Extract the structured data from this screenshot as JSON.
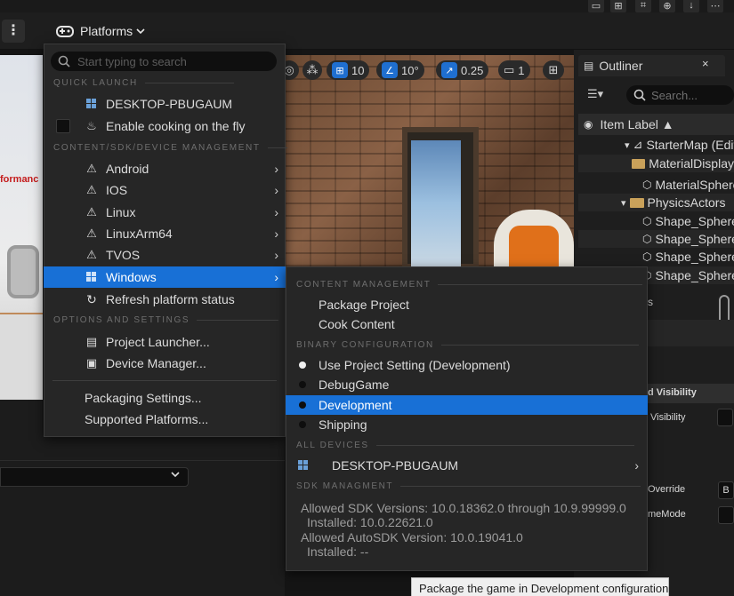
{
  "toolbar": {
    "platforms_label": "Platforms",
    "kebab_label": "⋮"
  },
  "platforms_menu": {
    "search_placeholder": "Start typing to search",
    "sections": {
      "quick_launch": "QUICK LAUNCH",
      "content_sdk": "CONTENT/SDK/DEVICE MANAGEMENT",
      "options": "OPTIONS AND SETTINGS"
    },
    "quick_launch": {
      "device": "DESKTOP-PBUGAUM",
      "cooking": "Enable cooking on the fly"
    },
    "platforms": [
      {
        "label": "Android"
      },
      {
        "label": "IOS"
      },
      {
        "label": "Linux"
      },
      {
        "label": "LinuxArm64"
      },
      {
        "label": "TVOS"
      },
      {
        "label": "Windows",
        "selected": true
      }
    ],
    "refresh": "Refresh platform status",
    "options": {
      "project_launcher": "Project Launcher...",
      "device_manager": "Device Manager..."
    },
    "packaging_settings": "Packaging Settings...",
    "supported_platforms": "Supported Platforms..."
  },
  "windows_menu": {
    "sections": {
      "content": "CONTENT MANAGEMENT",
      "binary": "BINARY CONFIGURATION",
      "all_devices": "ALL DEVICES",
      "sdk": "SDK MANAGMENT"
    },
    "package_project": "Package Project",
    "cook_content": "Cook Content",
    "configs": [
      {
        "label": "Use Project Setting (Development)",
        "checked": true
      },
      {
        "label": "DebugGame",
        "checked": false
      },
      {
        "label": "Development",
        "checked": false,
        "highlighted": true
      },
      {
        "label": "Shipping",
        "checked": false
      }
    ],
    "device": "DESKTOP-PBUGAUM",
    "sdk_lines": [
      "Allowed SDK Versions: 10.0.18362.0 through 10.9.99999.0",
      "Installed: 10.0.22621.0",
      "Allowed AutoSDK Version: 10.0.19041.0",
      "Installed: --"
    ]
  },
  "viewport_toolbar": {
    "grid_value": "10",
    "angle_value": "10°",
    "scale_value": "0.25",
    "camera_value": "1"
  },
  "outliner": {
    "title": "Outliner",
    "close": "×",
    "search_placeholder": "Search...",
    "column_header": "Item Label ▲",
    "rows": [
      {
        "label": "StarterMap (Editor)"
      },
      {
        "label": "MaterialDisplay"
      },
      {
        "label": "MaterialSphere"
      },
      {
        "label": "PhysicsActors"
      },
      {
        "label": "Shape_Sphere"
      },
      {
        "label": "Shape_Sphere"
      },
      {
        "label": "Shape_Sphere"
      },
      {
        "label": "Shape_Sphere"
      }
    ]
  },
  "details": {
    "s_label": "s",
    "visibility_header": "d Visibility",
    "visibility": "Visibility",
    "override": "Override",
    "override_value": "B",
    "game_mode": "meMode"
  },
  "left_view": {
    "red_text": "formanc"
  },
  "tooltip": "Package the game in Development configuration"
}
